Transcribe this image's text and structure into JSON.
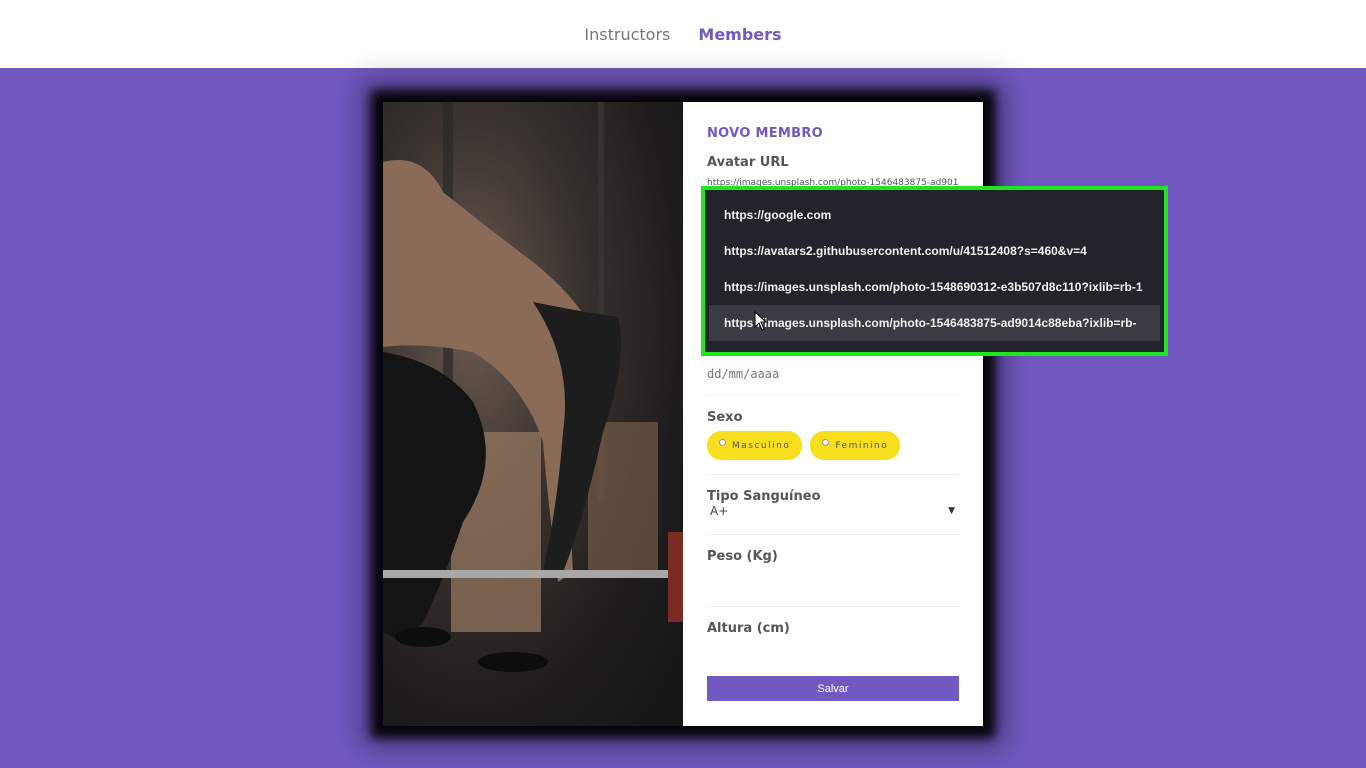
{
  "nav": {
    "items": [
      {
        "label": "Instructors",
        "active": false
      },
      {
        "label": "Members",
        "active": true
      }
    ]
  },
  "form": {
    "title": "NOVO MEMBRO",
    "avatar": {
      "label": "Avatar URL",
      "value": "https://images.unsplash.com/photo-1546483875-ad9014c88eba?ixlib=rb-"
    },
    "birth": {
      "placeholder": "dd/mm/aaaa"
    },
    "gender": {
      "label": "Sexo",
      "options": [
        "Masculino",
        "Feminino"
      ]
    },
    "blood": {
      "label": "Tipo Sanguíneo",
      "selected": "A+"
    },
    "weight": {
      "label": "Peso (Kg)"
    },
    "height": {
      "label": "Altura (cm)"
    },
    "save_label": "Salvar"
  },
  "autocomplete": {
    "items": [
      "https://google.com",
      "https://avatars2.githubusercontent.com/u/41512408?s=460&v=4",
      "https://images.unsplash.com/photo-1548690312-e3b507d8c110?ixlib=rb-1",
      "https://images.unsplash.com/photo-1546483875-ad9014c88eba?ixlib=rb-"
    ],
    "hovered_index": 3
  },
  "colors": {
    "brand": "#7159c1",
    "pill": "#f7df1e",
    "highlight_border": "#1fe61f",
    "dropdown_bg": "#23232b"
  },
  "icons": {
    "caret": "caret-down-icon",
    "cursor": "mouse-cursor-icon"
  }
}
